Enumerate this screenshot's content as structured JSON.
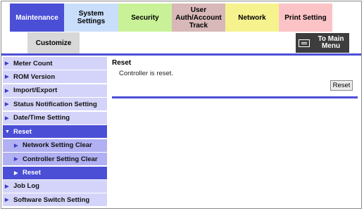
{
  "tabs": [
    {
      "label": "Maintenance"
    },
    {
      "label": "System Settings"
    },
    {
      "label": "Security"
    },
    {
      "label": "User\nAuth/Account\nTrack"
    },
    {
      "label": "Network"
    },
    {
      "label": "Print Setting"
    }
  ],
  "customize_tab": "Customize",
  "to_main_menu": "To Main\nMenu",
  "sidebar": [
    {
      "label": "Meter Count"
    },
    {
      "label": "ROM Version"
    },
    {
      "label": "Import/Export"
    },
    {
      "label": "Status Notification Setting"
    },
    {
      "label": "Date/Time Setting"
    },
    {
      "label": "Reset"
    },
    {
      "label": "Network Setting Clear"
    },
    {
      "label": "Controller Setting Clear"
    },
    {
      "label": "Reset"
    },
    {
      "label": "Job Log"
    },
    {
      "label": "Software Switch Setting"
    }
  ],
  "icons": {
    "collapsed": "▶",
    "expanded": "▼",
    "to_main_menu": "monitor-icon"
  },
  "content": {
    "title": "Reset",
    "message": "Controller is reset.",
    "button": "Reset"
  },
  "colors": {
    "accent": "#4b4fd6",
    "sidebar_item": "#d4d4fa",
    "sidebar_subitem": "#b0b0f2"
  }
}
